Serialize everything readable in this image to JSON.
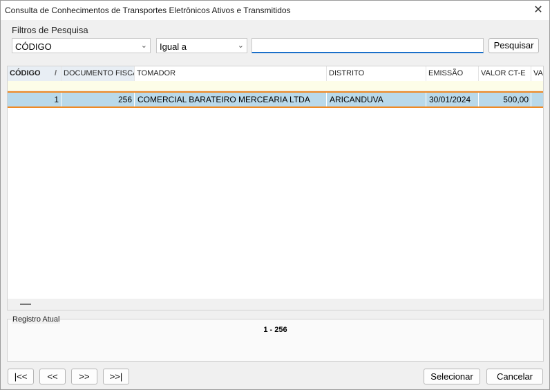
{
  "window": {
    "title": "Consulta de Conhecimentos de Transportes Eletrônicos Ativos e Transmitidos",
    "close_glyph": "✕"
  },
  "filters": {
    "legend": "Filtros de Pesquisa",
    "field_value": "CÓDIGO",
    "operator_value": "Igual a",
    "search_value": "",
    "search_button": "Pesquisar"
  },
  "grid": {
    "columns": [
      "CÓDIGO",
      "DOCUMENTO FISCAL",
      "TOMADOR",
      "DISTRITO",
      "EMISSÃO",
      "VALOR CT-E",
      "VAL"
    ],
    "sort_indicator": "/",
    "rows": [
      {
        "codigo": "1",
        "documento": "256",
        "tomador": "COMERCIAL BARATEIRO MERCEARIA LTDA",
        "distrito": "ARICANDUVA",
        "emissao": "30/01/2024",
        "valor": "500,00"
      }
    ]
  },
  "registro": {
    "label": "Registro Atual",
    "value": "1 - 256"
  },
  "nav": {
    "first": "|<<",
    "prev": "<<",
    "next": ">>",
    "last": ">>|"
  },
  "actions": {
    "select": "Selecionar",
    "cancel": "Cancelar"
  },
  "colors": {
    "selected_row": "#b9d9ea",
    "selection_border": "#f08a24",
    "search_underline": "#1a6fc9"
  }
}
